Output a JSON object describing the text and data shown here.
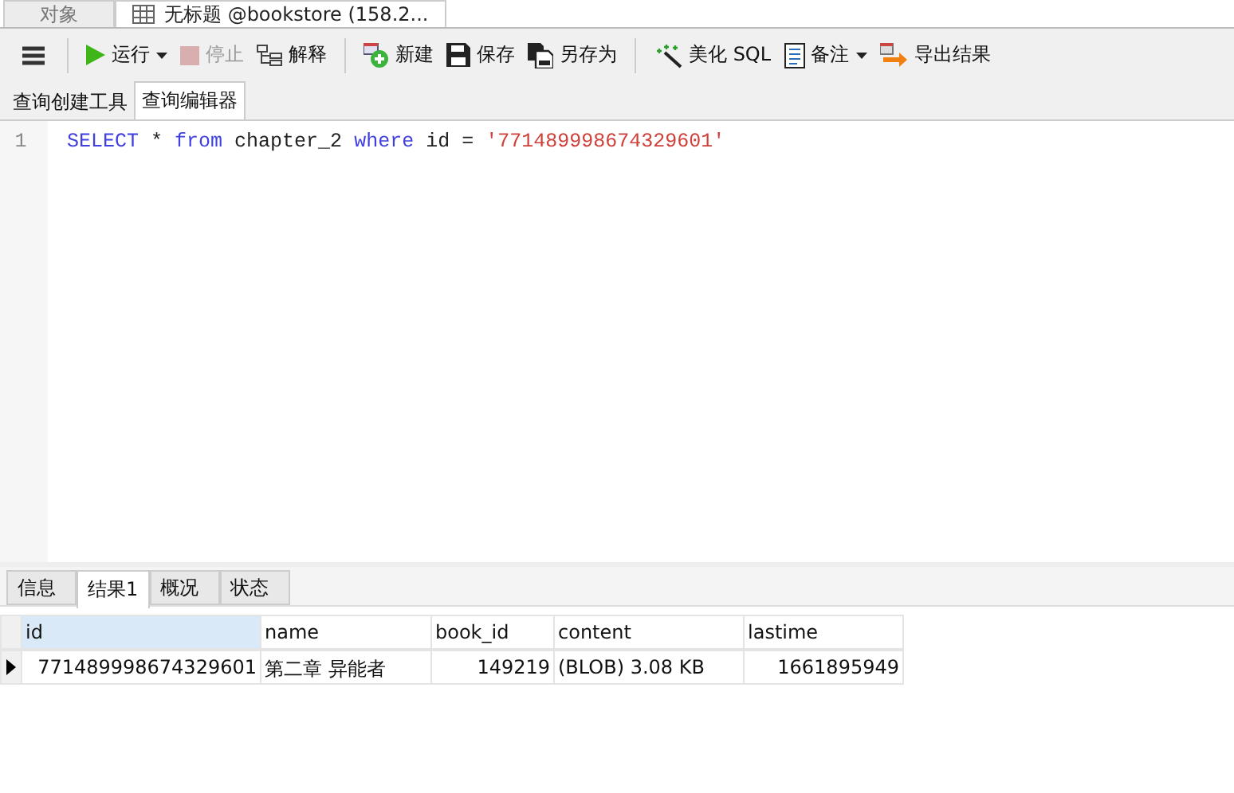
{
  "document_tabs": [
    {
      "label": "对象",
      "selected": false
    },
    {
      "label": "无标题 @bookstore (158.2...",
      "selected": true
    }
  ],
  "toolbar": [
    {
      "kind": "menu"
    },
    {
      "kind": "run",
      "label": "运行",
      "dropdown": true,
      "disabled": false
    },
    {
      "kind": "stop",
      "label": "停止",
      "dropdown": false,
      "disabled": true
    },
    {
      "kind": "explain",
      "label": "解释",
      "dropdown": false,
      "disabled": false
    },
    {
      "kind": "separator"
    },
    {
      "kind": "new",
      "label": "新建",
      "dropdown": false,
      "disabled": false
    },
    {
      "kind": "save",
      "label": "保存",
      "dropdown": false,
      "disabled": false
    },
    {
      "kind": "saveas",
      "label": "另存为",
      "dropdown": false,
      "disabled": false
    },
    {
      "kind": "separator"
    },
    {
      "kind": "beautify",
      "label": "美化 SQL",
      "dropdown": false,
      "disabled": false
    },
    {
      "kind": "note",
      "label": "备注",
      "dropdown": true,
      "disabled": false
    },
    {
      "kind": "export",
      "label": "导出结果",
      "dropdown": false,
      "disabled": false
    }
  ],
  "editor_tabs": [
    {
      "label": "查询创建工具",
      "selected": false
    },
    {
      "label": "查询编辑器",
      "selected": true
    }
  ],
  "editor": {
    "lines": [
      {
        "number": "1",
        "tokens": [
          {
            "kind": "keyword",
            "text": "SELECT"
          },
          {
            "kind": "plain",
            "text": " * "
          },
          {
            "kind": "keyword",
            "text": "from"
          },
          {
            "kind": "plain",
            "text": " chapter_2 "
          },
          {
            "kind": "keyword",
            "text": "where"
          },
          {
            "kind": "plain",
            "text": " id = "
          },
          {
            "kind": "string",
            "text": "'771489998674329601'"
          }
        ]
      }
    ]
  },
  "result_tabs": [
    {
      "label": "信息",
      "selected": false
    },
    {
      "label": "结果1",
      "selected": true
    },
    {
      "label": "概况",
      "selected": false
    },
    {
      "label": "状态",
      "selected": false
    }
  ],
  "table": {
    "columns": [
      {
        "label": "id",
        "selected": true,
        "kind": "number"
      },
      {
        "label": "name",
        "selected": false,
        "kind": "text"
      },
      {
        "label": "book_id",
        "selected": false,
        "kind": "number"
      },
      {
        "label": "content",
        "selected": false,
        "kind": "text"
      },
      {
        "label": "lastime",
        "selected": false,
        "kind": "number"
      }
    ],
    "rows": [
      {
        "current": true,
        "cells": [
          "771489998674329601",
          "第二章 异能者",
          "149219",
          "(BLOB) 3.08 KB",
          "1661895949"
        ]
      }
    ]
  }
}
